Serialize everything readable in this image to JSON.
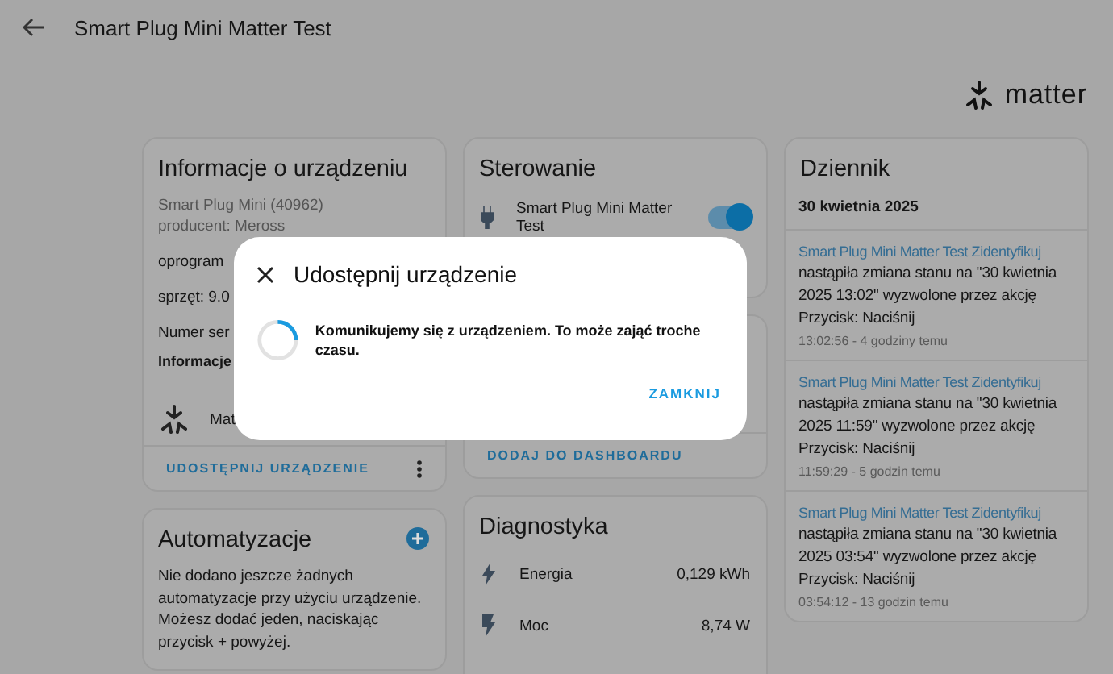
{
  "header": {
    "title": "Smart Plug Mini Matter Test"
  },
  "logo": {
    "text": "matter"
  },
  "device_info": {
    "title": "Informacje o urządzeniu",
    "model": "Smart Plug Mini (40962)",
    "manufacturer": "producent: Meross",
    "lines": [
      "oprogram",
      "sprzęt: 9.0",
      "Numer ser"
    ],
    "section": "Informacje",
    "integration": "Mat",
    "action": "UDOSTĘPNIJ URZĄDZENIE"
  },
  "automations": {
    "title": "Automatyzacje",
    "text": "Nie dodano jeszcze żadnych automatyzacje przy użyciu urządzenie. Możesz dodać jeden, naciskając przycisk + powyżej."
  },
  "controls": {
    "title": "Sterowanie",
    "entities": [
      {
        "name": "Smart Plug Mini Matter Test",
        "on": true
      }
    ]
  },
  "sensors_card": {
    "action": "DODAJ DO DASHBOARDU"
  },
  "diagnostics": {
    "title": "Diagnostyka",
    "rows": [
      {
        "kind": "energy",
        "name": "Energia",
        "value": "0,129 kWh"
      },
      {
        "kind": "power",
        "name": "Moc",
        "value": "8,74 W"
      }
    ]
  },
  "logbook": {
    "title": "Dziennik",
    "date": "30 kwietnia 2025",
    "entries": [
      {
        "link": "Smart Plug Mini Matter Test Zidentyfikuj",
        "text": "nastąpiła zmiana stanu na \"30 kwietnia 2025 13:02\" wyzwolone przez akcję Przycisk: Naciśnij",
        "time": "13:02:56 - 4 godziny temu"
      },
      {
        "link": "Smart Plug Mini Matter Test Zidentyfikuj",
        "text": "nastąpiła zmiana stanu na \"30 kwietnia 2025 11:59\" wyzwolone przez akcję Przycisk: Naciśnij",
        "time": "11:59:29 - 5 godzin temu"
      },
      {
        "link": "Smart Plug Mini Matter Test Zidentyfikuj",
        "text": "nastąpiła zmiana stanu na \"30 kwietnia 2025 03:54\" wyzwolone przez akcję Przycisk: Naciśnij",
        "time": "03:54:12 - 13 godzin temu"
      }
    ]
  },
  "dialog": {
    "title": "Udostępnij urządzenie",
    "message": "Komunikujemy się z urządzeniem. To może zająć troche czasu.",
    "button": "ZAMKNIJ"
  }
}
